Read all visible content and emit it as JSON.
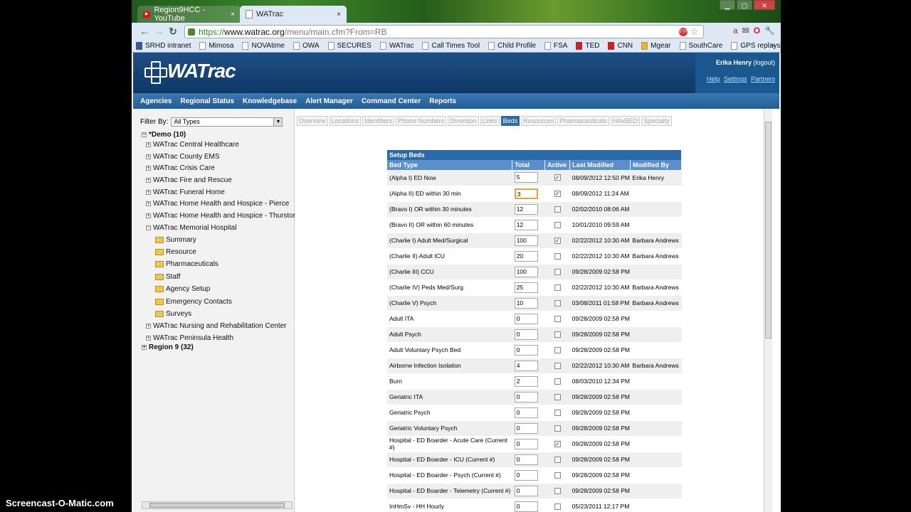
{
  "browser": {
    "tabs": [
      {
        "label": "Region9HCC - YouTube"
      },
      {
        "label": "WATrac"
      }
    ],
    "close_glyph": "×",
    "window_buttons": {
      "minimize": "▁",
      "maximize": "▢",
      "close": "✕"
    },
    "url": {
      "scheme": "https://",
      "host": "www.watrac.org",
      "path": "/menu/main.cfm?From=RB"
    },
    "stp_badge": "STP",
    "bookmarks": [
      "SRHD intranet",
      "Mimosa",
      "NOVAtime",
      "OWA",
      "SECURES",
      "WATrac",
      "Call Times Tool",
      "Child Profile",
      "FSA",
      "TED",
      "CNN",
      "Mgear",
      "SouthCare",
      "GPS replays"
    ],
    "bookmarks_more": "»"
  },
  "app": {
    "logo_text": "WATrac",
    "user": {
      "name": "Erika Henry",
      "logout": "(logout)",
      "links": [
        "Help",
        "Settings",
        "Partners"
      ]
    },
    "menu": [
      "Agencies",
      "Regional Status",
      "Knowledgebase",
      "Alert Manager",
      "Command Center",
      "Reports"
    ],
    "filter": {
      "label": "Filter By:",
      "value": "All Types"
    },
    "tree": {
      "root": "*Demo (10)",
      "agencies": [
        "WATrac Central Healthcare",
        "WATrac County EMS",
        "WATrac Crisis Care",
        "WATrac Fire and Rescue",
        "WATrac Funeral Home",
        "WATrac Home Health and Hospice - Pierce",
        "WATrac Home Health and Hospice - Thurston",
        "WATrac Memorial Hospital"
      ],
      "hospital_items": [
        "Summary",
        "Resource",
        "Pharmaceuticals",
        "Staff",
        "Agency Setup",
        "Emergency Contacts",
        "Surveys"
      ],
      "agencies_after": [
        "WATrac Nursing and Rehabilitation Center",
        "WATrac Peninsula Health"
      ],
      "region": "Region 9 (32)"
    },
    "subtabs": [
      "Overview",
      "Locations",
      "Identifiers",
      "Phone Numbers",
      "Diversion",
      "Links",
      "Beds",
      "Resources",
      "Pharmaceuticals",
      "HAvBED",
      "Specialty"
    ],
    "active_subtab": "Beds",
    "table": {
      "caption": "Setup Beds",
      "headers": [
        "Bed Type",
        "Total",
        "Active",
        "Last Modified",
        "Modified By"
      ],
      "rows": [
        {
          "type": "(Alpha I) ED Now",
          "total": "5",
          "active": true,
          "modified": "08/09/2012 12:50 PM",
          "by": "Erika Henry"
        },
        {
          "type": "(Alpha II) ED within 30 min",
          "total": "3",
          "active": true,
          "modified": "08/09/2012 11:24 AM",
          "by": ""
        },
        {
          "type": "(Bravo I) OR within 30 minutes",
          "total": "12",
          "active": false,
          "modified": "02/02/2010 08:06 AM",
          "by": ""
        },
        {
          "type": "(Bravo II) OR within 60 minutes",
          "total": "12",
          "active": false,
          "modified": "10/01/2010 09:59 AM",
          "by": ""
        },
        {
          "type": "(Charlie I) Adult Med/Surgical",
          "total": "100",
          "active": true,
          "modified": "02/22/2012 10:30 AM",
          "by": "Barbara Andrews"
        },
        {
          "type": "(Charlie II) Adult ICU",
          "total": "20",
          "active": false,
          "modified": "02/22/2012 10:30 AM",
          "by": "Barbara Andrews"
        },
        {
          "type": "(Charlie III) CCU",
          "total": "100",
          "active": false,
          "modified": "09/28/2009 02:58 PM",
          "by": ""
        },
        {
          "type": "(Charlie IV) Peds Med/Surg",
          "total": "25",
          "active": false,
          "modified": "02/22/2012 10:30 AM",
          "by": "Barbara Andrews"
        },
        {
          "type": "(Charlie V) Psych",
          "total": "10",
          "active": false,
          "modified": "03/08/2011 01:58 PM",
          "by": "Barbara Andrews"
        },
        {
          "type": "Adult ITA",
          "total": "0",
          "active": false,
          "modified": "09/28/2009 02:58 PM",
          "by": ""
        },
        {
          "type": "Adult Psych",
          "total": "0",
          "active": false,
          "modified": "09/28/2009 02:58 PM",
          "by": ""
        },
        {
          "type": "Adult Voluntary Psych Bed",
          "total": "0",
          "active": false,
          "modified": "09/28/2009 02:58 PM",
          "by": ""
        },
        {
          "type": "Airborne Infection Isolation",
          "total": "4",
          "active": false,
          "modified": "02/22/2012 10:30 AM",
          "by": "Barbara Andrews"
        },
        {
          "type": "Burn",
          "total": "2",
          "active": false,
          "modified": "08/03/2010 12:34 PM",
          "by": ""
        },
        {
          "type": "Geriatric ITA",
          "total": "0",
          "active": false,
          "modified": "09/28/2009 02:58 PM",
          "by": ""
        },
        {
          "type": "Geriatric Psych",
          "total": "0",
          "active": false,
          "modified": "09/28/2009 02:58 PM",
          "by": ""
        },
        {
          "type": "Geriatric Voluntary Psych",
          "total": "0",
          "active": false,
          "modified": "09/28/2009 02:58 PM",
          "by": ""
        },
        {
          "type": "Hospital - ED Boarder - Acute Care (Current #)",
          "total": "0",
          "active": true,
          "modified": "09/28/2009 02:58 PM",
          "by": ""
        },
        {
          "type": "Hospital - ED Boarder - ICU (Current #)",
          "total": "0",
          "active": false,
          "modified": "09/28/2009 02:58 PM",
          "by": ""
        },
        {
          "type": "Hospital - ED Boarder - Psych (Current #)",
          "total": "0",
          "active": false,
          "modified": "09/28/2009 02:58 PM",
          "by": ""
        },
        {
          "type": "Hospital - ED Boarder - Telemetry (Current #)",
          "total": "0",
          "active": false,
          "modified": "09/28/2009 02:58 PM",
          "by": ""
        },
        {
          "type": "InHmSv - HH Hourly",
          "total": "0",
          "active": false,
          "modified": "05/23/2011 12:17 PM",
          "by": ""
        }
      ]
    }
  },
  "watermark": "Screencast-O-Matic.com"
}
